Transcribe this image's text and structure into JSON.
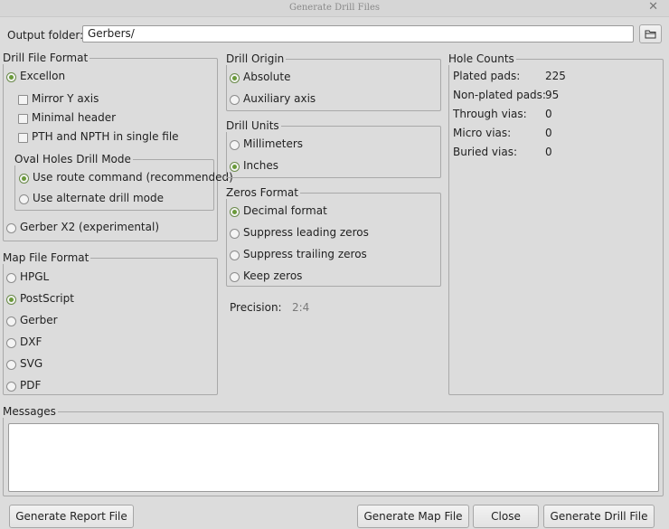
{
  "window": {
    "title": "Generate Drill Files"
  },
  "output": {
    "label": "Output folder:",
    "value": "Gerbers/"
  },
  "drill_file_format": {
    "title": "Drill File Format",
    "excellon": "Excellon",
    "mirror_y": "Mirror Y axis",
    "minimal_header": "Minimal header",
    "pth_npth": "PTH and NPTH in single file",
    "oval_title": "Oval Holes Drill Mode",
    "use_route": "Use route command (recommended)",
    "use_alt": "Use alternate drill mode",
    "gerber_x2": "Gerber X2 (experimental)"
  },
  "map_file_format": {
    "title": "Map File Format",
    "options": [
      "HPGL",
      "PostScript",
      "Gerber",
      "DXF",
      "SVG",
      "PDF"
    ],
    "selected": "PostScript"
  },
  "drill_origin": {
    "title": "Drill Origin",
    "absolute": "Absolute",
    "auxiliary": "Auxiliary axis",
    "selected": "Absolute"
  },
  "drill_units": {
    "title": "Drill Units",
    "mm": "Millimeters",
    "inches": "Inches",
    "selected": "Inches"
  },
  "zeros_format": {
    "title": "Zeros Format",
    "decimal": "Decimal format",
    "suppress_leading": "Suppress leading zeros",
    "suppress_trailing": "Suppress trailing zeros",
    "keep": "Keep zeros",
    "selected": "Decimal format"
  },
  "precision": {
    "label": "Precision:",
    "value": "2:4"
  },
  "hole_counts": {
    "title": "Hole Counts",
    "rows": [
      {
        "label": "Plated pads:",
        "value": "225"
      },
      {
        "label": "Non-plated pads:",
        "value": "95"
      },
      {
        "label": "Through vias:",
        "value": "0"
      },
      {
        "label": "Micro vias:",
        "value": "0"
      },
      {
        "label": "Buried vias:",
        "value": "0"
      }
    ]
  },
  "messages": {
    "title": "Messages",
    "text": ""
  },
  "buttons": {
    "report": "Generate Report File",
    "map": "Generate Map File",
    "close": "Close",
    "drill": "Generate Drill File"
  },
  "icons": {
    "window_close": "close-icon",
    "browse": "folder-icon"
  }
}
